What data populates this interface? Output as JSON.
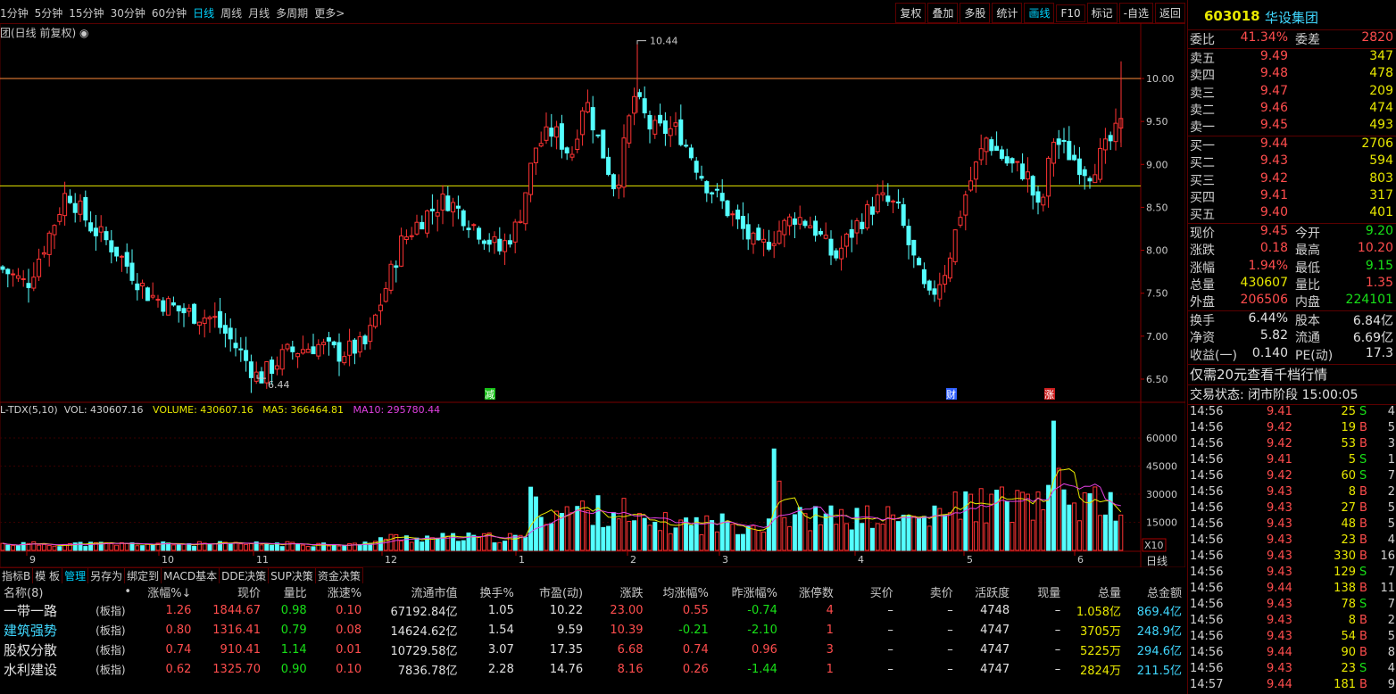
{
  "toolbar": {
    "periods": [
      "1分钟",
      "5分钟",
      "15分钟",
      "30分钟",
      "60分钟",
      "日线",
      "周线",
      "月线",
      "多周期",
      "更多>"
    ],
    "active_period": "日线",
    "tools": [
      "复权",
      "叠加",
      "多股",
      "统计",
      "画线",
      "F10",
      "标记",
      "-自选",
      "返回"
    ],
    "active_tool": "画线"
  },
  "chart_title": "团(日线 前复权) ◉",
  "main_chart": {
    "y_ticks": [
      "10.00",
      "9.50",
      "9.00",
      "8.50",
      "8.00",
      "7.50",
      "7.00",
      "6.50"
    ],
    "high_marker": "10.44",
    "low_marker": "6.44",
    "event_tags": [
      "减",
      "财",
      "涨"
    ],
    "colors": {
      "up": "#ff3333",
      "down": "#54ffff",
      "line_upper": "#ff8a3a",
      "line_lower": "#e8e800"
    }
  },
  "volume_legend": {
    "name": "L-TDX(5,10)",
    "vol": "VOL: 430607.16",
    "volume": "VOLUME: 430607.16",
    "ma5": "MA5: 366464.81",
    "ma10": "MA10: 295780.44"
  },
  "volume_chart": {
    "y_ticks": [
      "60000",
      "45000",
      "30000",
      "15000"
    ],
    "unit": "X10",
    "x_labels": [
      "9",
      "10",
      "11",
      "12",
      "1",
      "2",
      "3",
      "4",
      "5",
      "6"
    ],
    "daily_label": "日线"
  },
  "bottom_tabs": [
    "指标B",
    "模 板",
    "管理",
    "另存为",
    "绑定到",
    "MACD基本",
    "DDE决策",
    "SUP决策",
    "资金决策"
  ],
  "active_bottom_tab": "管理",
  "table": {
    "headers": [
      "名称(8)",
      "•",
      "涨幅%↓",
      "现价",
      "量比",
      "涨速%",
      "流通市值",
      "换手%",
      "市盈(动)",
      "涨跌",
      "均涨幅%",
      "昨涨幅%",
      "涨停数",
      "买价",
      "卖价",
      "活跃度",
      "现量",
      "总量",
      "总金额"
    ],
    "rows": [
      {
        "name": "一带一路",
        "tag": "(板指)",
        "chg": "1.26",
        "price": "1844.67",
        "vr": "0.98",
        "speed": "0.10",
        "mcap": "67192.84亿",
        "turn": "1.05",
        "pe": "10.22",
        "diff": "23.00",
        "avg": "0.55",
        "prev": "-0.74",
        "limit": "4",
        "bid": "–",
        "ask": "–",
        "active": "4748",
        "cur": "–",
        "vol": "1.058亿",
        "amt": "869.4亿"
      },
      {
        "name": "建筑强势",
        "tag": "(板指)",
        "chg": "0.80",
        "price": "1316.41",
        "vr": "0.79",
        "speed": "0.08",
        "mcap": "14624.62亿",
        "turn": "1.54",
        "pe": "9.59",
        "diff": "10.39",
        "avg": "-0.21",
        "prev": "-2.10",
        "limit": "1",
        "bid": "–",
        "ask": "–",
        "active": "4747",
        "cur": "–",
        "vol": "3705万",
        "amt": "248.9亿"
      },
      {
        "name": "股权分散",
        "tag": "(板指)",
        "chg": "0.74",
        "price": "910.41",
        "vr": "1.14",
        "speed": "0.01",
        "mcap": "10729.58亿",
        "turn": "3.07",
        "pe": "17.35",
        "diff": "6.68",
        "avg": "0.74",
        "prev": "0.96",
        "limit": "3",
        "bid": "–",
        "ask": "–",
        "active": "4747",
        "cur": "–",
        "vol": "5225万",
        "amt": "294.6亿"
      },
      {
        "name": "水利建设",
        "tag": "(板指)",
        "chg": "0.62",
        "price": "1325.70",
        "vr": "0.90",
        "speed": "0.10",
        "mcap": "7836.78亿",
        "turn": "2.28",
        "pe": "14.76",
        "diff": "8.16",
        "avg": "0.26",
        "prev": "-1.44",
        "limit": "1",
        "bid": "–",
        "ask": "–",
        "active": "4747",
        "cur": "–",
        "vol": "2824万",
        "amt": "211.5亿"
      }
    ]
  },
  "quote": {
    "code": "603018",
    "name": "华设集团",
    "ratio_label": "委比",
    "ratio": "41.34%",
    "diff_label": "委差",
    "diff": "2820",
    "asks": [
      {
        "label": "卖五",
        "price": "9.49",
        "vol": "347"
      },
      {
        "label": "卖四",
        "price": "9.48",
        "vol": "478"
      },
      {
        "label": "卖三",
        "price": "9.47",
        "vol": "209"
      },
      {
        "label": "卖二",
        "price": "9.46",
        "vol": "474"
      },
      {
        "label": "卖一",
        "price": "9.45",
        "vol": "493"
      }
    ],
    "bids": [
      {
        "label": "买一",
        "price": "9.44",
        "vol": "2706"
      },
      {
        "label": "买二",
        "price": "9.43",
        "vol": "594"
      },
      {
        "label": "买三",
        "price": "9.42",
        "vol": "803"
      },
      {
        "label": "买四",
        "price": "9.41",
        "vol": "317"
      },
      {
        "label": "买五",
        "price": "9.40",
        "vol": "401"
      }
    ],
    "stats": [
      {
        "l": "现价",
        "v": "9.45",
        "vc": "red",
        "l2": "今开",
        "v2": "9.20",
        "v2c": "green"
      },
      {
        "l": "涨跌",
        "v": "0.18",
        "vc": "red",
        "l2": "最高",
        "v2": "10.20",
        "v2c": "red"
      },
      {
        "l": "涨幅",
        "v": "1.94%",
        "vc": "red",
        "l2": "最低",
        "v2": "9.15",
        "v2c": "green"
      },
      {
        "l": "总量",
        "v": "430607",
        "vc": "yellow",
        "l2": "量比",
        "v2": "1.35",
        "v2c": "red"
      },
      {
        "l": "外盘",
        "v": "206506",
        "vc": "red",
        "l2": "内盘",
        "v2": "224101",
        "v2c": "green"
      }
    ],
    "stats2": [
      {
        "l": "换手",
        "v": "6.44%",
        "l2": "股本",
        "v2": "6.84亿"
      },
      {
        "l": "净资",
        "v": "5.82",
        "l2": "流通",
        "v2": "6.69亿"
      },
      {
        "l": "收益(一)",
        "v": "0.140",
        "l2": "PE(动)",
        "v2": "17.3"
      }
    ],
    "promo": "仅需20元查看千档行情",
    "status": "交易状态: 闭市阶段 15:00:05",
    "ticks": [
      {
        "t": "14:56",
        "p": "9.41",
        "q": "25",
        "bs": "S",
        "n": "4"
      },
      {
        "t": "14:56",
        "p": "9.42",
        "q": "19",
        "bs": "B",
        "n": "5"
      },
      {
        "t": "14:56",
        "p": "9.42",
        "q": "53",
        "bs": "B",
        "n": "3"
      },
      {
        "t": "14:56",
        "p": "9.41",
        "q": "5",
        "bs": "S",
        "n": "1"
      },
      {
        "t": "14:56",
        "p": "9.42",
        "q": "60",
        "bs": "S",
        "n": "7"
      },
      {
        "t": "14:56",
        "p": "9.43",
        "q": "8",
        "bs": "B",
        "n": "2"
      },
      {
        "t": "14:56",
        "p": "9.43",
        "q": "27",
        "bs": "B",
        "n": "5"
      },
      {
        "t": "14:56",
        "p": "9.43",
        "q": "48",
        "bs": "B",
        "n": "5"
      },
      {
        "t": "14:56",
        "p": "9.43",
        "q": "23",
        "bs": "B",
        "n": "4"
      },
      {
        "t": "14:56",
        "p": "9.43",
        "q": "330",
        "bs": "B",
        "n": "16"
      },
      {
        "t": "14:56",
        "p": "9.43",
        "q": "129",
        "bs": "S",
        "n": "7"
      },
      {
        "t": "14:56",
        "p": "9.44",
        "q": "138",
        "bs": "B",
        "n": "11"
      },
      {
        "t": "14:56",
        "p": "9.43",
        "q": "78",
        "bs": "S",
        "n": "7"
      },
      {
        "t": "14:56",
        "p": "9.43",
        "q": "8",
        "bs": "B",
        "n": "2"
      },
      {
        "t": "14:56",
        "p": "9.43",
        "q": "54",
        "bs": "B",
        "n": "5"
      },
      {
        "t": "14:56",
        "p": "9.44",
        "q": "90",
        "bs": "B",
        "n": "8"
      },
      {
        "t": "14:56",
        "p": "9.43",
        "q": "23",
        "bs": "S",
        "n": "4"
      },
      {
        "t": "14:57",
        "p": "9.44",
        "q": "181",
        "bs": "B",
        "n": "9"
      }
    ]
  }
}
